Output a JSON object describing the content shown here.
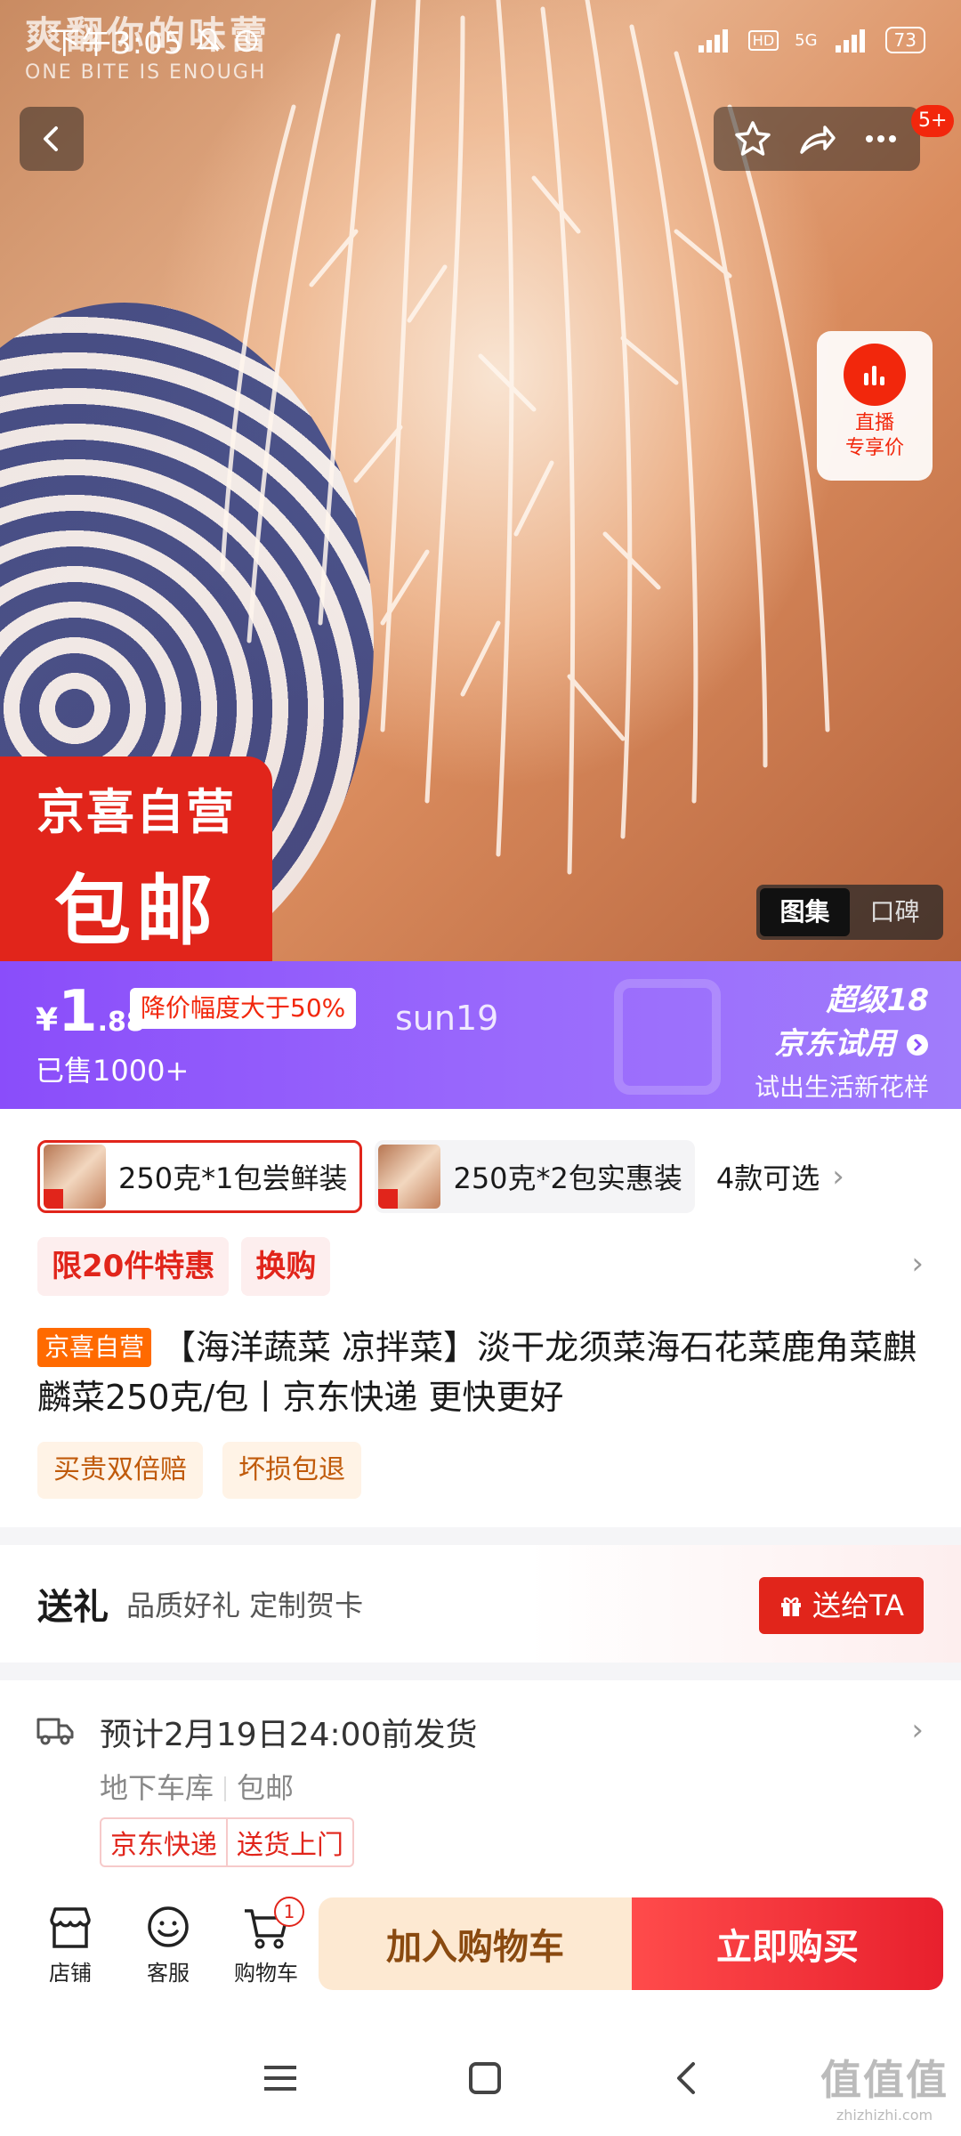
{
  "status_bar": {
    "time": "下午3:05",
    "battery": "73",
    "network": "5G",
    "hd": "HD"
  },
  "hero": {
    "overlay_text": "爽翻你的味蕾",
    "overlay_sub": "ONE BITE IS ENOUGH",
    "promo_line1": "京喜自营",
    "promo_line2": "包邮",
    "live_label_1": "直播",
    "live_label_2": "专享价",
    "more_badge": "5+",
    "gallery_tabs": [
      "图集",
      "口碑"
    ]
  },
  "price_band": {
    "currency": "¥",
    "price_int": "1",
    "price_dec": ".88",
    "drop_tag": "降价幅度大于50%",
    "sold": "已售1000+",
    "watermark_user": "sun19",
    "trial_line1": "超级18",
    "trial_line2": "京东试用",
    "trial_line3": "试出生活新花样"
  },
  "sku": {
    "options": [
      "250克*1包尝鲜装",
      "250克*2包实惠装"
    ],
    "more": "4款可选"
  },
  "promo_tags": [
    "限20件特惠",
    "换购"
  ],
  "product": {
    "badge": "京喜自营",
    "title": "【海洋蔬菜 凉拌菜】淡干龙须菜海石花菜鹿角菜麒麟菜250克/包丨京东快递 更快更好"
  },
  "services": [
    "买贵双倍赔",
    "坏损包退"
  ],
  "gift": {
    "title": "送礼",
    "desc": "品质好礼 定制贺卡",
    "button": "送给TA"
  },
  "shipping": {
    "estimate": "预计2月19日24:00前发货",
    "location": "地下车库",
    "free_ship": "包邮",
    "tags": [
      "京东快递",
      "送货上门"
    ]
  },
  "action_bar": {
    "shop": "店铺",
    "service": "客服",
    "cart": "购物车",
    "cart_count": "1",
    "add_to_cart": "加入购物车",
    "buy_now": "立即购买"
  },
  "watermark": {
    "logo": "值值值",
    "url": "zhizhizhi.com"
  },
  "colors": {
    "brand_red": "#e1251b",
    "purple": "#8a4dfa",
    "cart_bg": "#fde9d2"
  }
}
